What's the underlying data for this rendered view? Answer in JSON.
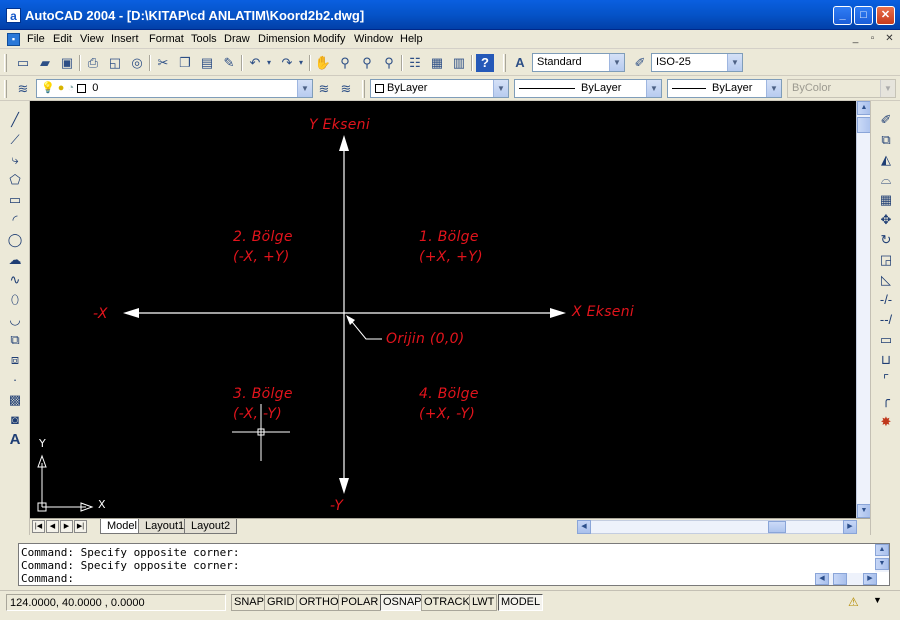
{
  "window": {
    "app_icon": "a",
    "title": "AutoCAD 2004 - [D:\\KITAP\\cd ANLATIM\\Koord2b2.dwg]",
    "controls": {
      "minimize": "_",
      "maximize": "□",
      "close": "✕"
    }
  },
  "menu": {
    "items": [
      "File",
      "Edit",
      "View",
      "Insert",
      "Format",
      "Tools",
      "Draw",
      "Dimension",
      "Modify",
      "Window",
      "Help"
    ],
    "mdi_controls": [
      "_",
      "▫",
      "✕"
    ]
  },
  "toolbar_standard": {
    "icons": [
      "new-icon",
      "open-icon",
      "save-icon",
      "plot-icon",
      "plot-preview-icon",
      "publish-icon",
      "cut-icon",
      "copy-icon",
      "paste-icon",
      "match-properties-icon",
      "undo-icon",
      "redo-icon",
      "pan-icon",
      "zoom-realtime-icon",
      "zoom-window-icon",
      "zoom-previous-icon",
      "properties-icon",
      "design-center-icon",
      "tool-palettes-icon",
      "help-icon"
    ],
    "text_style": "Standard",
    "dim_style": "ISO-25"
  },
  "toolbar_layers": {
    "layer_name": "0",
    "color": "ByLayer",
    "linetype": "ByLayer",
    "lineweight": "ByLayer",
    "plot_style": "ByColor"
  },
  "drawing": {
    "y_axis_label": "Y Ekseni",
    "x_axis_label": "X Ekseni",
    "neg_x_label": "-X",
    "neg_y_label": "-Y",
    "origin_label": "Orijin (0,0)",
    "quadrants": [
      {
        "name": "1. Bölge",
        "signs": "(+X, +Y)"
      },
      {
        "name": "2. Bölge",
        "signs": "(-X, +Y)"
      },
      {
        "name": "3. Bölge",
        "signs": "(-X, -Y)"
      },
      {
        "name": "4. Bölge",
        "signs": "(+X, -Y)"
      }
    ],
    "ucs_x": "X",
    "ucs_y": "Y",
    "annotation_color": "#e2141c",
    "background": "#000000"
  },
  "tabs": {
    "items": [
      "Model",
      "Layout1",
      "Layout2"
    ],
    "active": "Model"
  },
  "command_window": {
    "lines": [
      "Command: Specify opposite corner:",
      "Command: Specify opposite corner:",
      "Command:"
    ]
  },
  "status_bar": {
    "coordinates": "124.0000, 40.0000 , 0.0000",
    "buttons": [
      "SNAP",
      "GRID",
      "ORTHO",
      "POLAR",
      "OSNAP",
      "OTRACK",
      "LWT",
      "MODEL"
    ]
  }
}
